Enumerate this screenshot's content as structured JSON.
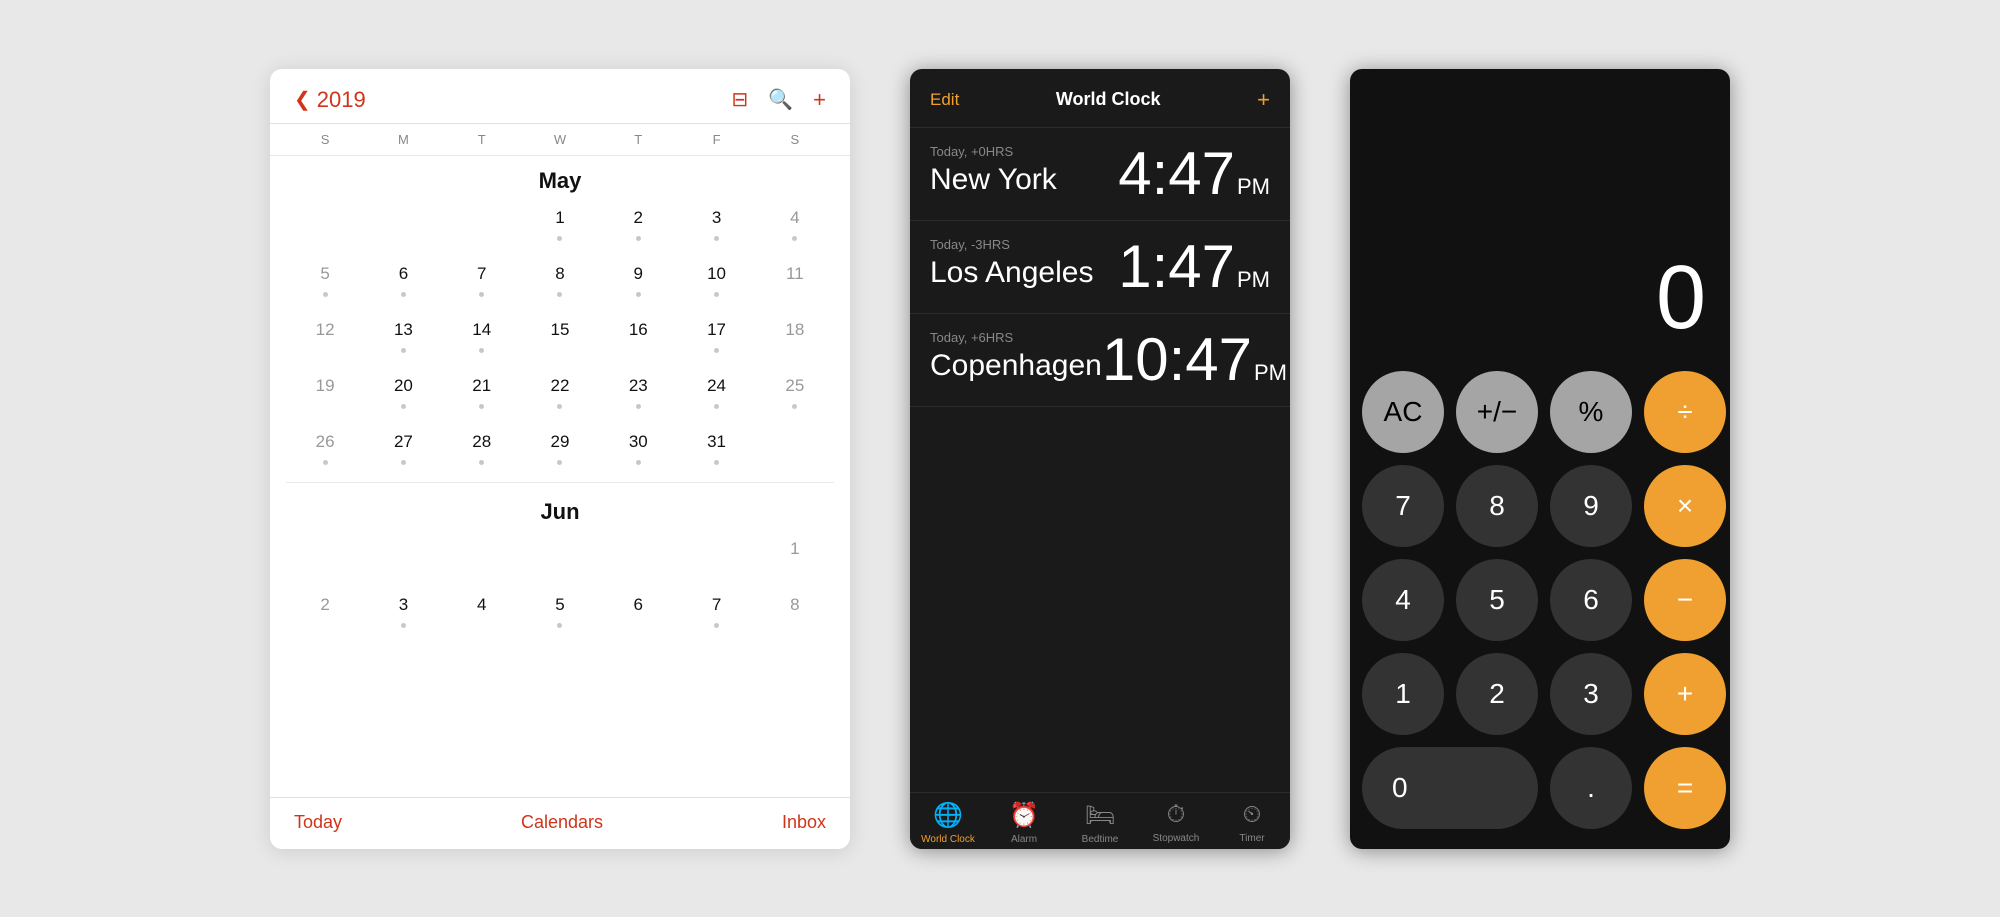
{
  "calendar": {
    "year": "2019",
    "back_icon": "❮",
    "search_icon": "🔍",
    "grid_icon": "▤",
    "add_icon": "+",
    "weekdays": [
      "S",
      "M",
      "T",
      "W",
      "T",
      "F",
      "S"
    ],
    "month_may": "May",
    "month_jun": "Jun",
    "footer": {
      "today": "Today",
      "calendars": "Calendars",
      "inbox": "Inbox"
    },
    "may_days": [
      {
        "num": "",
        "weekend": false,
        "dot": false
      },
      {
        "num": "",
        "weekend": false,
        "dot": false
      },
      {
        "num": "",
        "weekend": false,
        "dot": false
      },
      {
        "num": "1",
        "weekend": false,
        "dot": true
      },
      {
        "num": "2",
        "weekend": false,
        "dot": true
      },
      {
        "num": "3",
        "weekend": false,
        "dot": true
      },
      {
        "num": "4",
        "weekend": true,
        "dot": true
      },
      {
        "num": "5",
        "weekend": true,
        "dot": true
      },
      {
        "num": "6",
        "weekend": false,
        "dot": true
      },
      {
        "num": "7",
        "weekend": false,
        "dot": true
      },
      {
        "num": "8",
        "weekend": false,
        "dot": true
      },
      {
        "num": "9",
        "weekend": false,
        "dot": true
      },
      {
        "num": "10",
        "weekend": false,
        "dot": true
      },
      {
        "num": "11",
        "weekend": true,
        "dot": false
      },
      {
        "num": "12",
        "weekend": true,
        "dot": false
      },
      {
        "num": "13",
        "weekend": false,
        "dot": true
      },
      {
        "num": "14",
        "weekend": false,
        "dot": true
      },
      {
        "num": "15",
        "weekend": false,
        "dot": false
      },
      {
        "num": "16",
        "weekend": false,
        "dot": false
      },
      {
        "num": "17",
        "weekend": false,
        "dot": true
      },
      {
        "num": "18",
        "weekend": true,
        "dot": false
      },
      {
        "num": "19",
        "weekend": true,
        "dot": false
      },
      {
        "num": "20",
        "weekend": false,
        "dot": true
      },
      {
        "num": "21",
        "weekend": false,
        "dot": true
      },
      {
        "num": "22",
        "weekend": false,
        "dot": true
      },
      {
        "num": "23",
        "weekend": false,
        "dot": true
      },
      {
        "num": "24",
        "weekend": false,
        "dot": true
      },
      {
        "num": "25",
        "weekend": true,
        "dot": true
      },
      {
        "num": "26",
        "weekend": true,
        "dot": true
      },
      {
        "num": "27",
        "weekend": false,
        "dot": true
      },
      {
        "num": "28",
        "weekend": false,
        "dot": true
      },
      {
        "num": "29",
        "weekend": false,
        "dot": true
      },
      {
        "num": "30",
        "weekend": false,
        "dot": true
      },
      {
        "num": "31",
        "weekend": false,
        "dot": true
      },
      {
        "num": "",
        "weekend": true,
        "dot": false
      }
    ],
    "jun_days": [
      {
        "num": "",
        "weekend": true,
        "dot": false
      },
      {
        "num": "",
        "weekend": false,
        "dot": false
      },
      {
        "num": "",
        "weekend": false,
        "dot": false
      },
      {
        "num": "",
        "weekend": false,
        "dot": false
      },
      {
        "num": "",
        "weekend": false,
        "dot": false
      },
      {
        "num": "",
        "weekend": false,
        "dot": false
      },
      {
        "num": "1",
        "weekend": true,
        "dot": false
      }
    ],
    "jun_days2": [
      {
        "num": "2",
        "weekend": true,
        "dot": false
      },
      {
        "num": "3",
        "weekend": false,
        "dot": true
      },
      {
        "num": "4",
        "weekend": false,
        "dot": false
      },
      {
        "num": "5",
        "weekend": false,
        "dot": true
      },
      {
        "num": "6",
        "weekend": false,
        "dot": false
      },
      {
        "num": "7",
        "weekend": false,
        "dot": true
      },
      {
        "num": "8",
        "weekend": true,
        "dot": false
      }
    ]
  },
  "clock": {
    "edit_label": "Edit",
    "title": "World Clock",
    "add_icon": "+",
    "clocks": [
      {
        "offset": "Today, +0HRS",
        "city": "New York",
        "time": "4:47",
        "ampm": "PM"
      },
      {
        "offset": "Today, -3HRS",
        "city": "Los Angeles",
        "time": "1:47",
        "ampm": "PM"
      },
      {
        "offset": "Today, +6HRS",
        "city": "Copenhagen",
        "time": "10:47",
        "ampm": "PM"
      }
    ],
    "tabs": [
      {
        "label": "World Clock",
        "active": true
      },
      {
        "label": "Alarm",
        "active": false
      },
      {
        "label": "Bedtime",
        "active": false
      },
      {
        "label": "Stopwatch",
        "active": false
      },
      {
        "label": "Timer",
        "active": false
      }
    ]
  },
  "calculator": {
    "display_value": "0",
    "buttons": [
      {
        "label": "AC",
        "type": "gray"
      },
      {
        "label": "+/−",
        "type": "gray"
      },
      {
        "label": "%",
        "type": "gray"
      },
      {
        "label": "÷",
        "type": "orange"
      },
      {
        "label": "7",
        "type": "dark"
      },
      {
        "label": "8",
        "type": "dark"
      },
      {
        "label": "9",
        "type": "dark"
      },
      {
        "label": "×",
        "type": "orange"
      },
      {
        "label": "4",
        "type": "dark"
      },
      {
        "label": "5",
        "type": "dark"
      },
      {
        "label": "6",
        "type": "dark"
      },
      {
        "label": "−",
        "type": "orange"
      },
      {
        "label": "1",
        "type": "dark"
      },
      {
        "label": "2",
        "type": "dark"
      },
      {
        "label": "3",
        "type": "dark"
      },
      {
        "label": "+",
        "type": "orange"
      },
      {
        "label": "0",
        "type": "dark",
        "zero": true
      },
      {
        "label": ".",
        "type": "dark"
      },
      {
        "label": "=",
        "type": "orange"
      }
    ]
  }
}
